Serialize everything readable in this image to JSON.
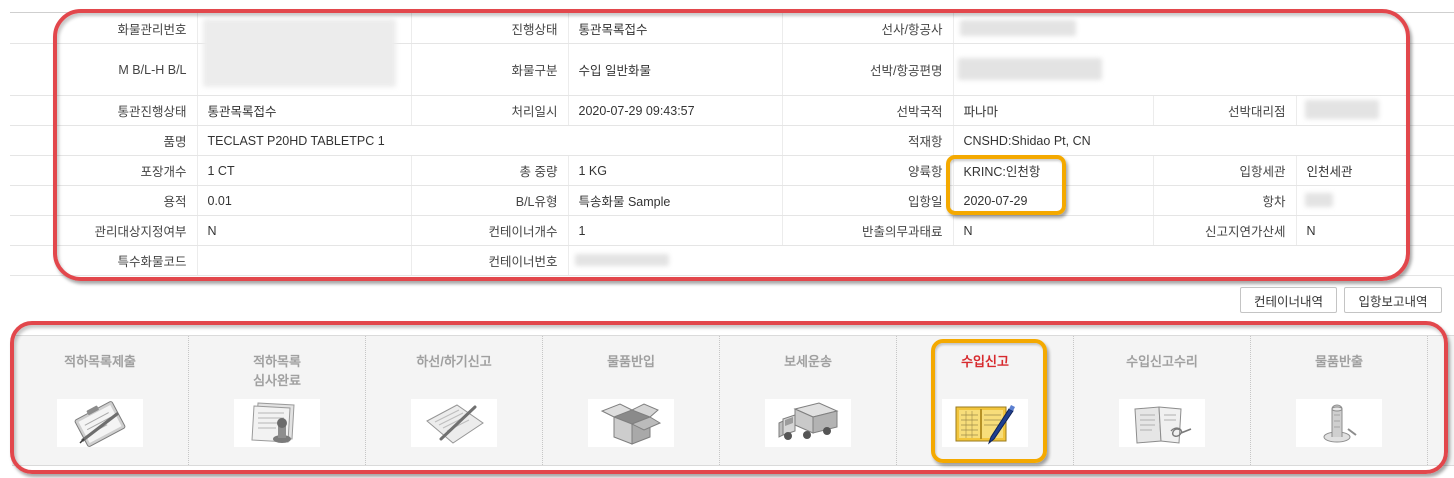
{
  "cargo": {
    "cargo_mgmt_no": {
      "label": "화물관리번호"
    },
    "progress_status": {
      "label": "진행상태",
      "value": "통관목록접수"
    },
    "carrier": {
      "label": "선사/항공사"
    },
    "mbl_hbl": {
      "label": "M B/L-H B/L"
    },
    "cargo_type": {
      "label": "화물구분",
      "value": "수입 일반화물"
    },
    "vessel_flight": {
      "label": "선박/항공편명"
    },
    "clearance_status": {
      "label": "통관진행상태",
      "value": "통관목록접수"
    },
    "processed_at": {
      "label": "처리일시",
      "value": "2020-07-29 09:43:57"
    },
    "vessel_nationality": {
      "label": "선박국적",
      "value": "파나마"
    },
    "shipping_agent": {
      "label": "선박대리점"
    },
    "item_name": {
      "label": "품명",
      "value": "TECLAST P20HD TABLETPC 1"
    },
    "loading_port": {
      "label": "적재항",
      "value": "CNSHD:Shidao Pt, CN"
    },
    "package_count": {
      "label": "포장개수",
      "value": "1 CT"
    },
    "gross_weight": {
      "label": "총 중량",
      "value": "1 KG"
    },
    "discharge_port": {
      "label": "양륙항",
      "value": "KRINC:인천항"
    },
    "entry_customs": {
      "label": "입항세관",
      "value": "인천세관"
    },
    "volume": {
      "label": "용적",
      "value": "0.01"
    },
    "bl_type": {
      "label": "B/L유형",
      "value": "특송화물 Sample"
    },
    "arrival_date": {
      "label": "입항일",
      "value": "2020-07-29"
    },
    "voyage": {
      "label": "항차"
    },
    "managed_target": {
      "label": "관리대상지정여부",
      "value": "N"
    },
    "container_count": {
      "label": "컨테이너개수",
      "value": "1"
    },
    "release_penalty": {
      "label": "반출의무과태료",
      "value": "N"
    },
    "late_report_surcharge": {
      "label": "신고지연가산세",
      "value": "N"
    },
    "special_cargo_code": {
      "label": "특수화물코드"
    },
    "container_no": {
      "label": "컨테이너번호"
    }
  },
  "actions": {
    "container_history": "컨테이너내역",
    "arrival_report": "입항보고내역"
  },
  "steps": [
    {
      "label": "적하목록제출",
      "icon": "clipboard-pen-icon"
    },
    {
      "label": "적하목록\n심사완료",
      "icon": "stamp-document-icon"
    },
    {
      "label": "하선/하기신고",
      "icon": "pen-paper-icon"
    },
    {
      "label": "물품반입",
      "icon": "box-icon"
    },
    {
      "label": "보세운송",
      "icon": "truck-icon"
    },
    {
      "label": "수입신고",
      "icon": "notebook-pen-icon",
      "active": true
    },
    {
      "label": "수입신고수리",
      "icon": "document-stamp-icon"
    },
    {
      "label": "물품반출",
      "icon": "stamp-icon"
    }
  ],
  "colors": {
    "active_step": "#d72a2e",
    "annotation_red": "#e2474c",
    "annotation_orange": "#f4a900",
    "step_inactive": "#a0a0a0"
  }
}
